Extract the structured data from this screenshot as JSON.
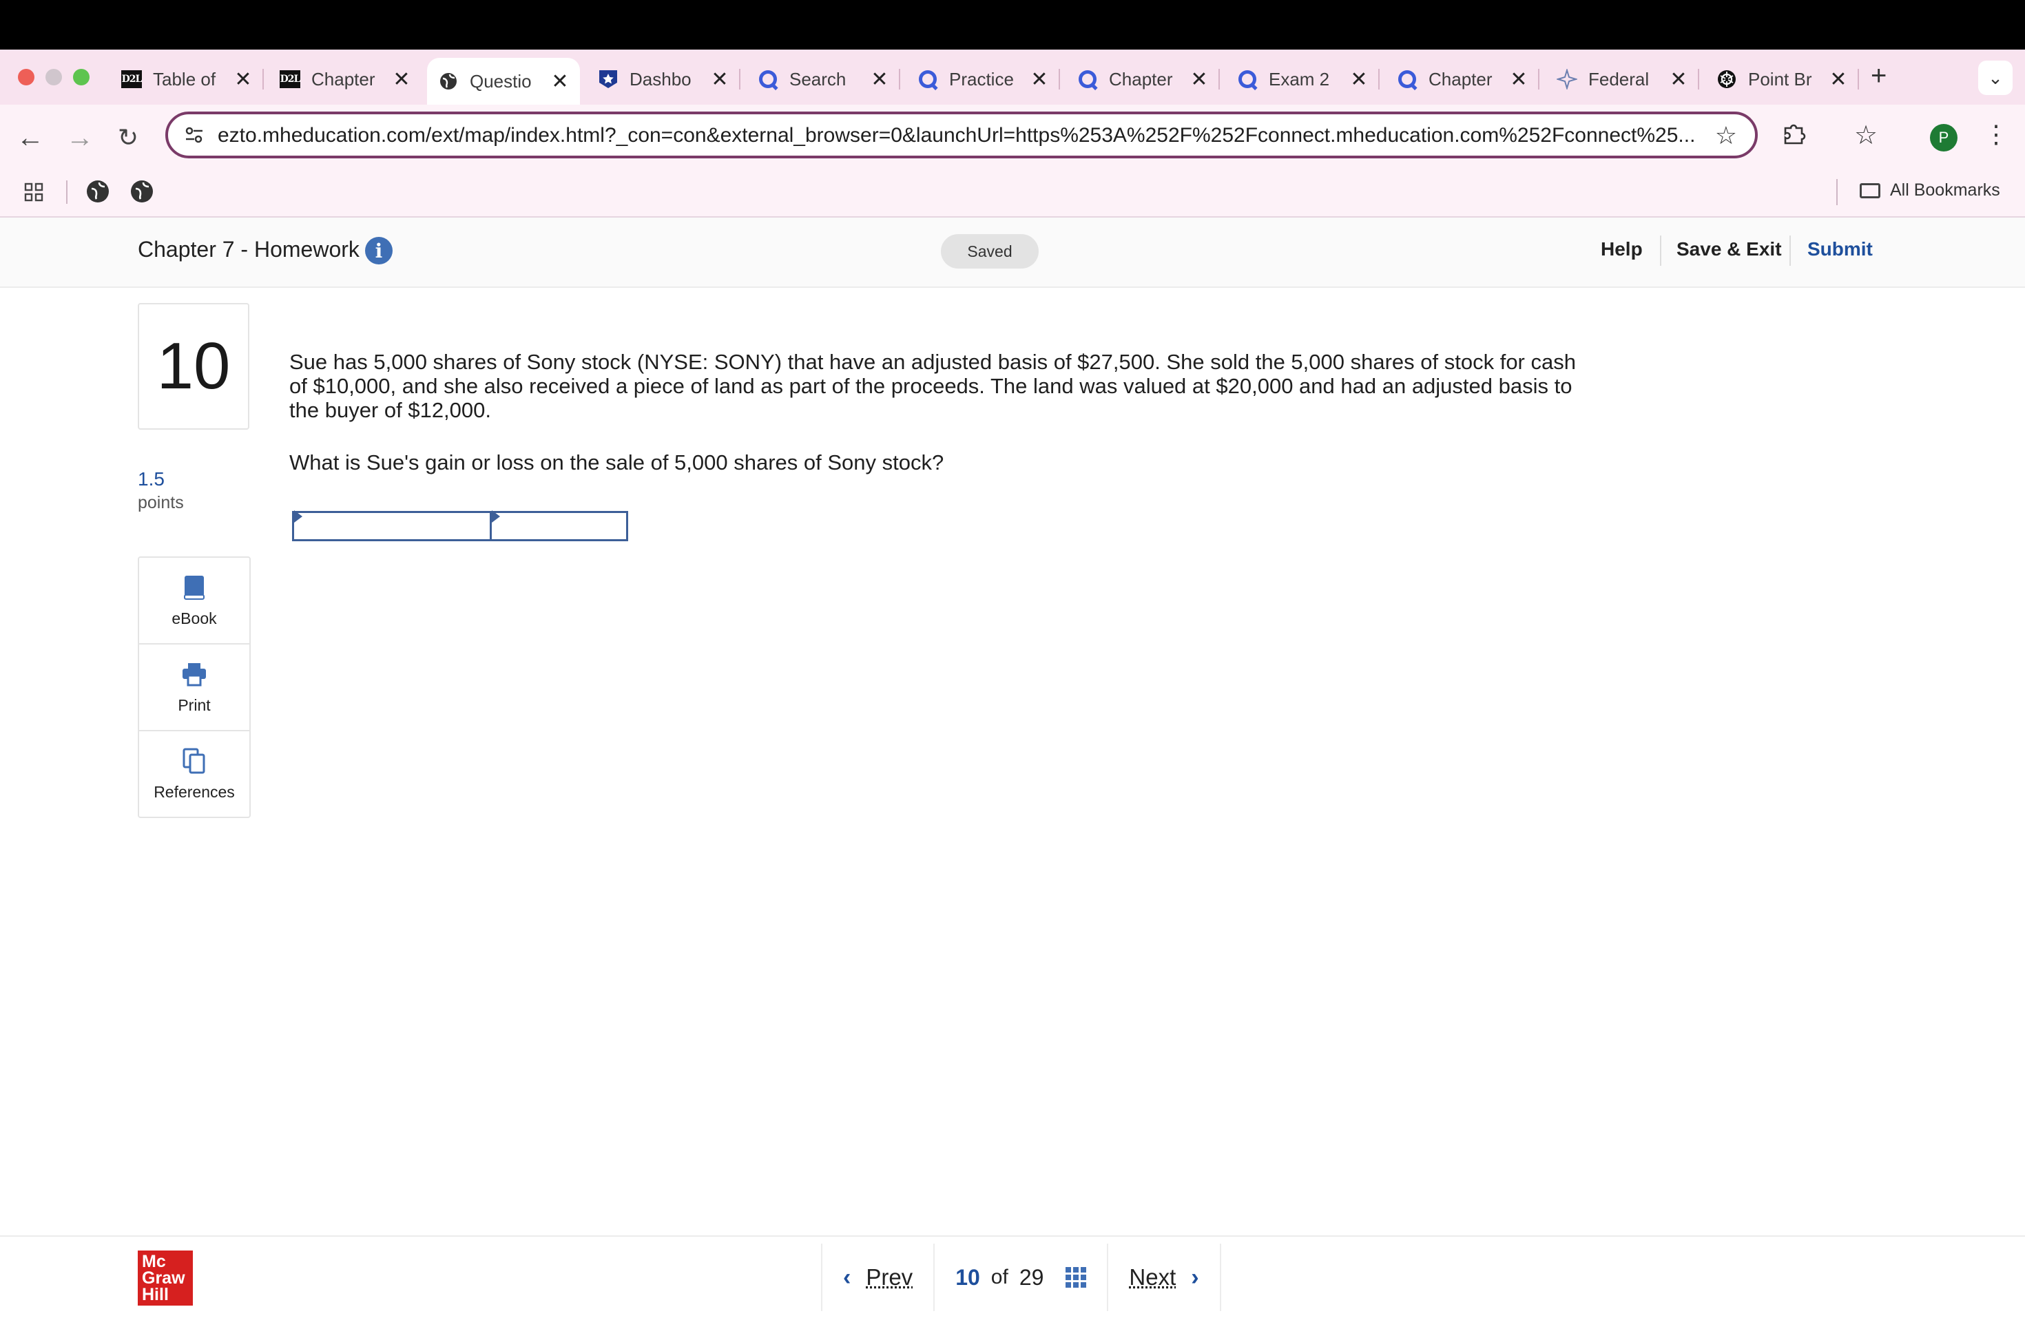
{
  "browser": {
    "tabs": [
      {
        "label": "Table of",
        "icon": "d2l-icon",
        "active": false
      },
      {
        "label": "Chapter",
        "icon": "d2l-icon",
        "active": false
      },
      {
        "label": "Questio",
        "icon": "globe-icon",
        "active": true
      },
      {
        "label": "Dashbo",
        "icon": "star-badge-icon",
        "active": false
      },
      {
        "label": "Search",
        "icon": "quizlet-icon",
        "active": false
      },
      {
        "label": "Practice",
        "icon": "quizlet-icon",
        "active": false
      },
      {
        "label": "Chapter",
        "icon": "quizlet-icon",
        "active": false
      },
      {
        "label": "Exam 2",
        "icon": "quizlet-icon",
        "active": false
      },
      {
        "label": "Chapter",
        "icon": "quizlet-icon",
        "active": false
      },
      {
        "label": "Federal",
        "icon": "sparkle-icon",
        "active": false
      },
      {
        "label": "Point Br",
        "icon": "openai-icon",
        "active": false
      }
    ],
    "url": "ezto.mheducation.com/ext/map/index.html?_con=con&external_browser=0&launchUrl=https%253A%252F%252Fconnect.mheducation.com%252Fconnect%25...",
    "profile_initial": "P",
    "all_bookmarks": "All Bookmarks"
  },
  "header": {
    "title": "Chapter 7 - Homework",
    "info": "i",
    "saved": "Saved",
    "help": "Help",
    "save_exit": "Save & Exit",
    "submit": "Submit"
  },
  "question": {
    "number": "10",
    "points_value": "1.5",
    "points_label": "points",
    "text": "Sue has 5,000 shares of Sony stock (NYSE: SONY) that have an adjusted basis of $27,500. She sold the 5,000 shares of stock for cash of $10,000, and she also received a piece of land as part of the proceeds. The land was valued at $20,000 and had an adjusted basis to the buyer of $12,000.",
    "ask": "What is Sue's gain or loss on the sale of 5,000 shares of Sony stock?",
    "answer_label": "",
    "answer_value": ""
  },
  "tools": {
    "ebook": "eBook",
    "print": "Print",
    "references": "References"
  },
  "footer": {
    "logo": "Mc Graw Hill",
    "logo_lines": [
      "Mc",
      "Graw",
      "Hill"
    ],
    "prev": "Prev",
    "current": "10",
    "of": "of",
    "total": "29",
    "next": "Next"
  }
}
